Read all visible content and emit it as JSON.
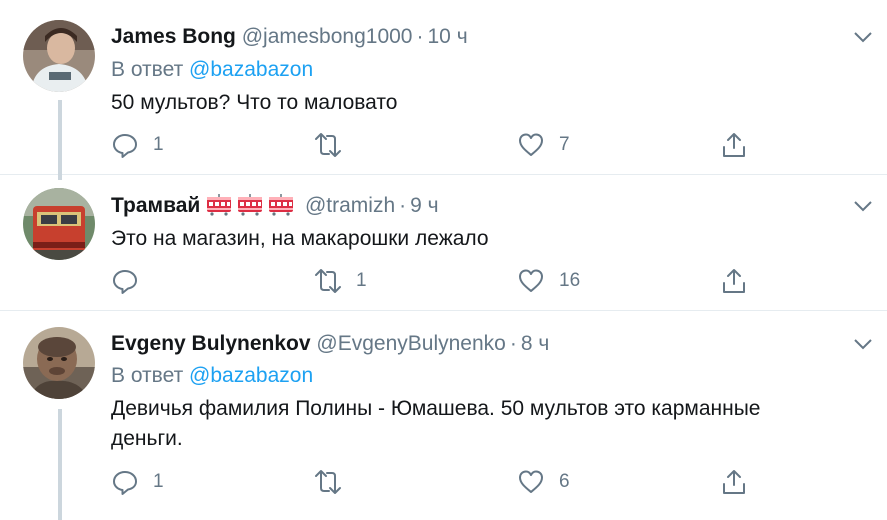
{
  "tweets": [
    {
      "name": "James Bong",
      "handle": "@jamesbong1000",
      "time": "10 ч",
      "reply_prefix": "В ответ",
      "reply_to": "@bazabazon",
      "text": "50 мультов? Что то маловато",
      "reply_count": "1",
      "retweet_count": "",
      "like_count": "7"
    },
    {
      "name": "Трамвай",
      "name_emoji": [
        "tram-car-emoji",
        "tram-car-emoji",
        "tram-car-emoji"
      ],
      "handle": "@tramizh",
      "time": "9 ч",
      "text": "Это на магазин, на макарошки лежало",
      "reply_count": "",
      "retweet_count": "1",
      "like_count": "16"
    },
    {
      "name": "Evgeny Bulynenkov",
      "handle": "@EvgenyBulynenko",
      "time": "8 ч",
      "reply_prefix": "В ответ",
      "reply_to": "@bazabazon",
      "text": "Девичья фамилия Полины - Юмашева. 50 мультов это карманные деньги.",
      "reply_count": "1",
      "retweet_count": "",
      "like_count": "6"
    }
  ],
  "colors": {
    "text": "#14171a",
    "secondary": "#657786",
    "link": "#1da1f2",
    "divider": "#e6ecf0",
    "thread_line": "#ccd6dd"
  },
  "dot_separator": "·"
}
